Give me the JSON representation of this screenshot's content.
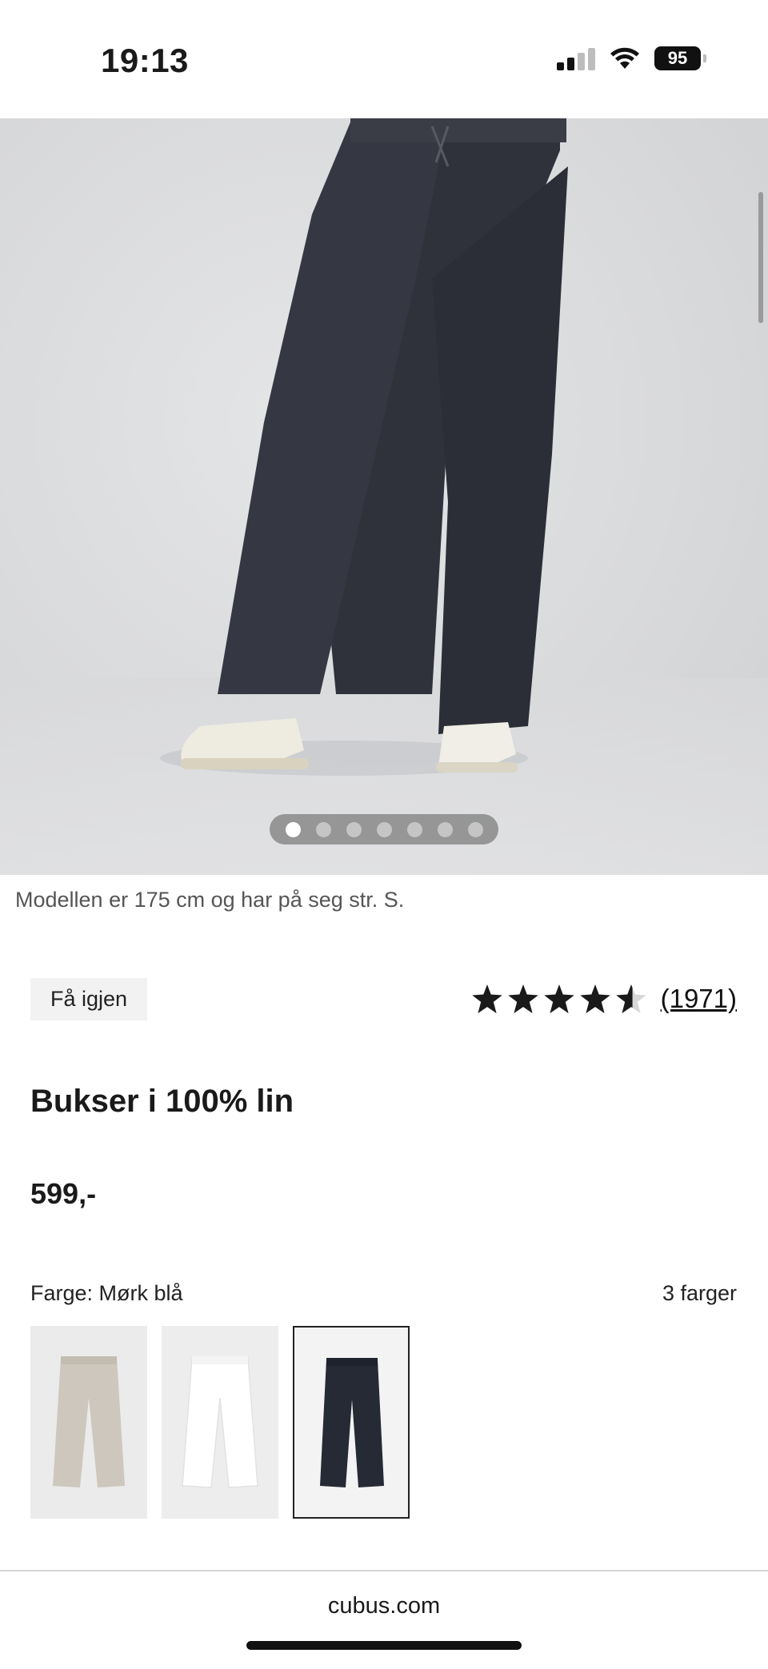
{
  "status_bar": {
    "time": "19:13",
    "battery": "95"
  },
  "product": {
    "model_note": "Modellen er 175 cm og har på seg str. S.",
    "tag": "Få igjen",
    "rating": {
      "value": 4.5,
      "max": 5,
      "review_count": "(1971)"
    },
    "title": "Bukser i 100% lin",
    "price": "599,-",
    "color_label": "Farge: Mørk blå",
    "color_count": "3 farger",
    "swatches": [
      {
        "name": "beige",
        "color": "#cdc7bd",
        "selected": false
      },
      {
        "name": "white",
        "color": "#ffffff",
        "selected": false
      },
      {
        "name": "dark-blue",
        "color": "#262a35",
        "selected": true
      }
    ]
  },
  "carousel": {
    "image_count": 7,
    "active_index": 0
  },
  "browser": {
    "url": "cubus.com"
  },
  "colors": {
    "pants": "#33363f",
    "accent": "#111111"
  }
}
